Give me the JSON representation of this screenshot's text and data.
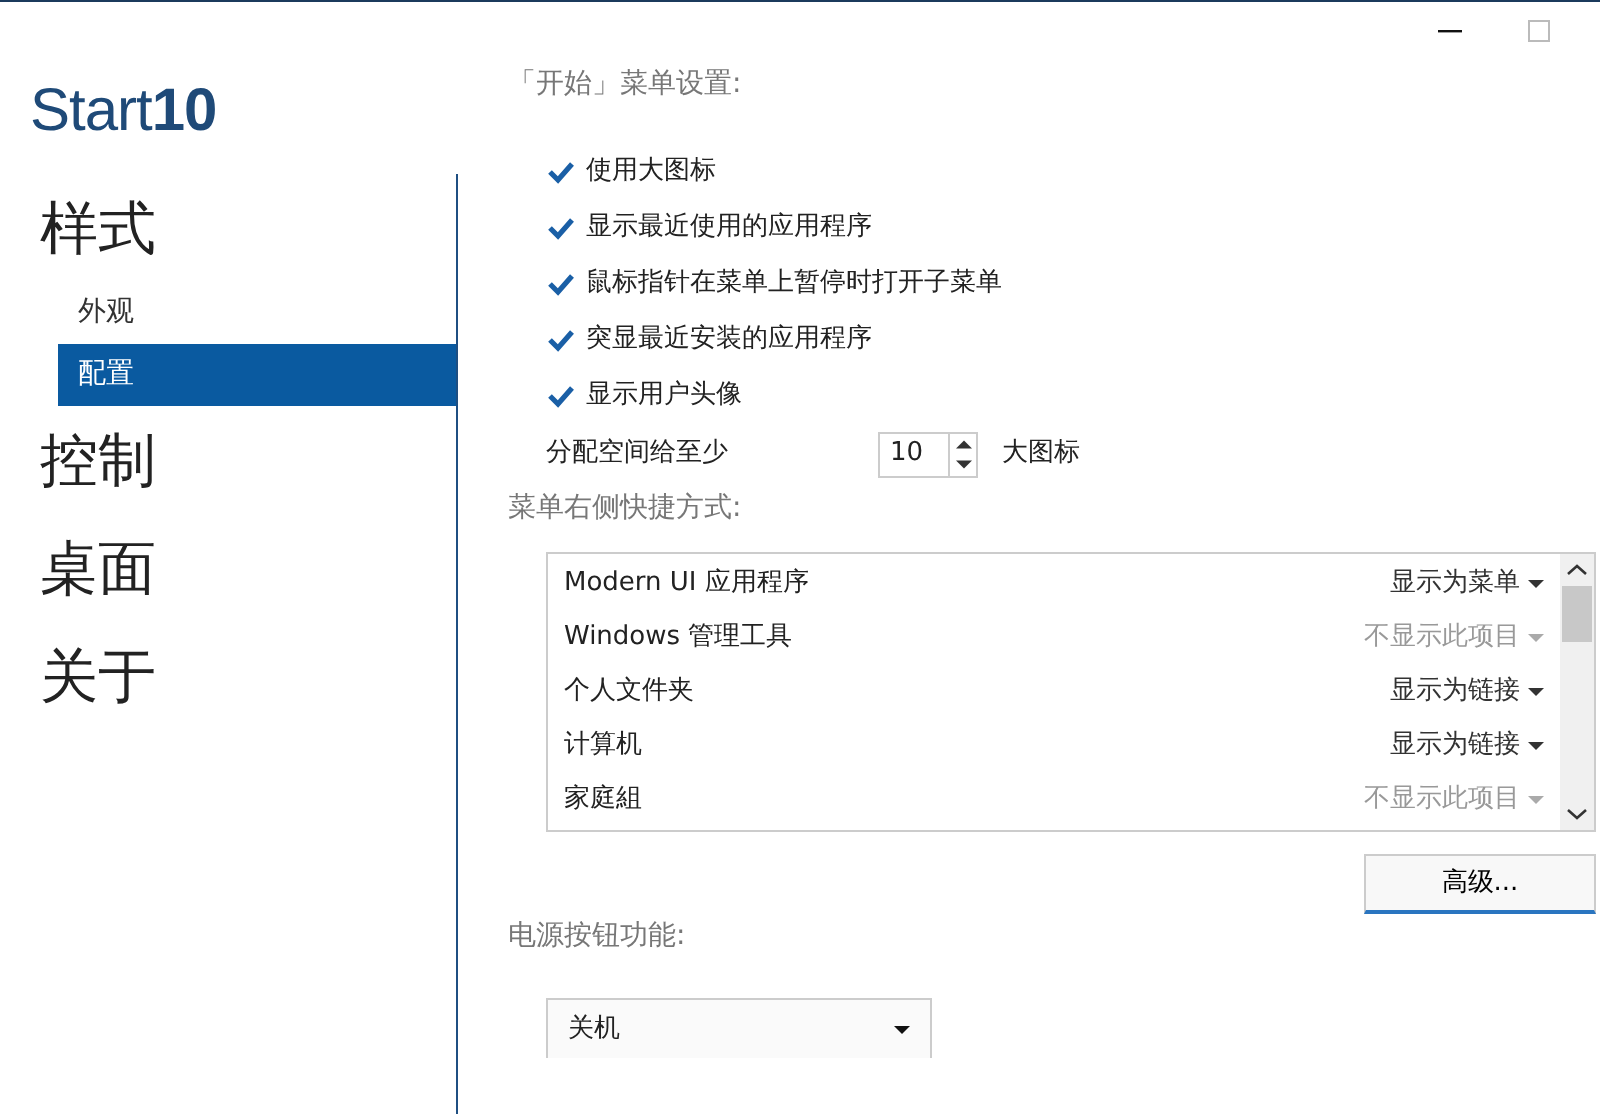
{
  "logo": "Start**10**",
  "nav": [
    {
      "label": "样式",
      "selected": false,
      "children": [
        {
          "label": "外观",
          "selected": false
        },
        {
          "label": "配置",
          "selected": true
        }
      ]
    },
    {
      "label": "控制",
      "selected": false
    },
    {
      "label": "桌面",
      "selected": false
    },
    {
      "label": "关于",
      "selected": false
    }
  ],
  "settings": {
    "title": "「开始」菜单设置:",
    "options": [
      {
        "label": "使用大图标",
        "checked": true
      },
      {
        "label": "显示最近使用的应用程序",
        "checked": true
      },
      {
        "label": "鼠标指针在菜单上暂停时打开子菜单",
        "checked": true
      },
      {
        "label": "突显最近安装的应用程序",
        "checked": true
      },
      {
        "label": "显示用户头像",
        "checked": true
      }
    ],
    "spinner": {
      "label": "分配空间给至少",
      "value": "10",
      "unit": "大图标"
    }
  },
  "shortcuts": {
    "title": "菜单右侧快捷方式:",
    "rows": [
      {
        "name": "Modern UI 应用程序",
        "value": "显示为菜单",
        "disabled": false
      },
      {
        "name": "Windows 管理工具",
        "value": "不显示此项目",
        "disabled": true
      },
      {
        "name": "个人文件夹",
        "value": "显示为链接",
        "disabled": false
      },
      {
        "name": "计算机",
        "value": "显示为链接",
        "disabled": false
      },
      {
        "name": "家庭組",
        "value": "不显示此项目",
        "disabled": true
      }
    ],
    "advanced_button": "高级..."
  },
  "power": {
    "title": "电源按钮功能:",
    "value": "关机"
  }
}
